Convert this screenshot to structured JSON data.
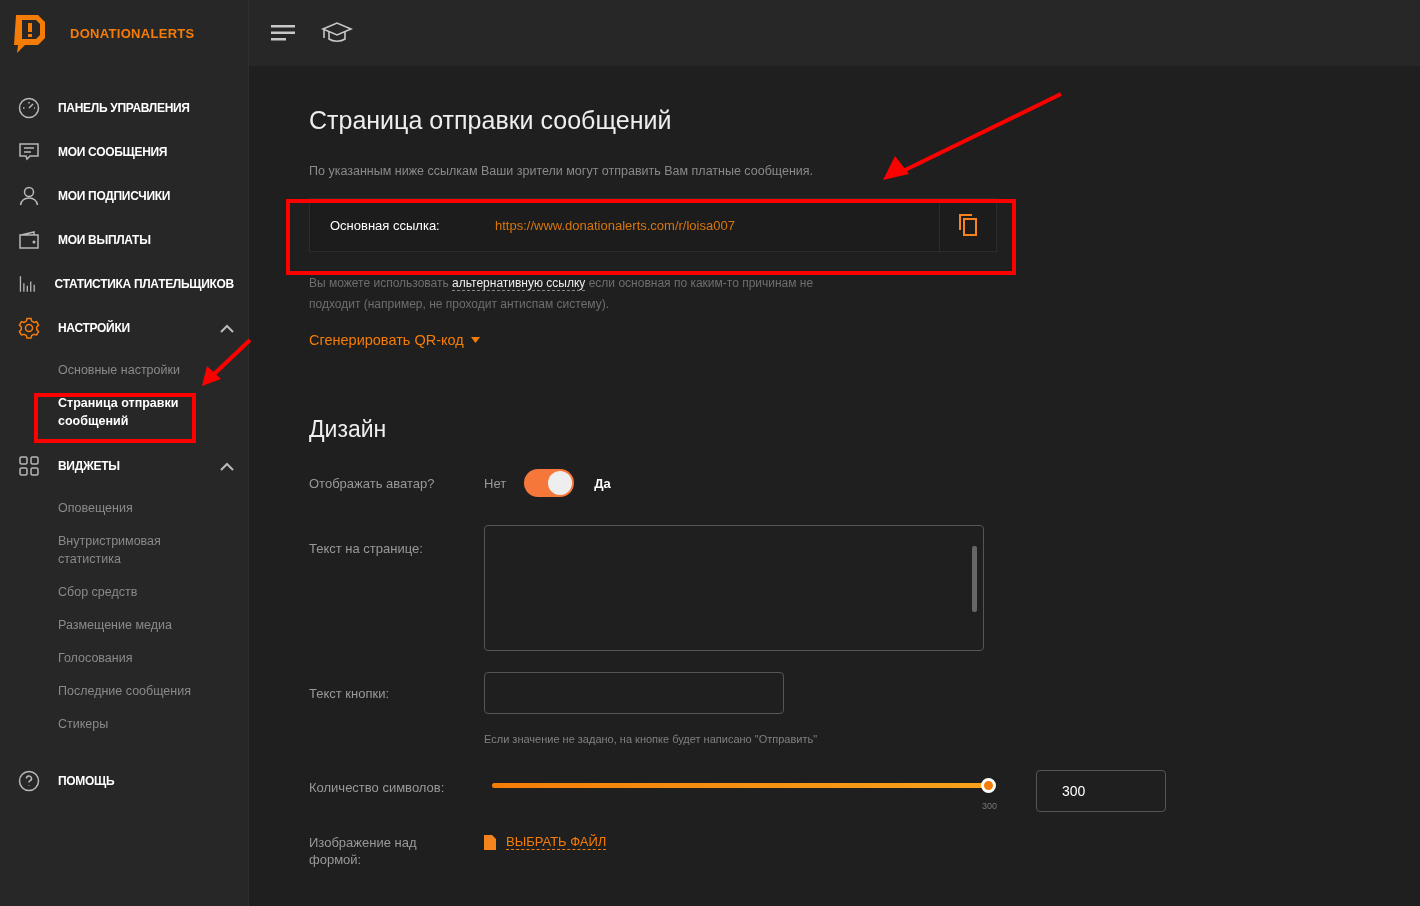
{
  "brand": {
    "name": "DONATIONALERTS"
  },
  "sidebar": {
    "items": [
      {
        "label": "ПАНЕЛЬ УПРАВЛЕНИЯ"
      },
      {
        "label": "МОИ СООБЩЕНИЯ"
      },
      {
        "label": "МОИ ПОДПИСЧИКИ"
      },
      {
        "label": "МОИ ВЫПЛАТЫ"
      },
      {
        "label": "СТАТИСТИКА ПЛАТЕЛЬЩИКОВ"
      },
      {
        "label": "НАСТРОЙКИ",
        "expanded": true,
        "children": [
          {
            "label": "Основные настройки",
            "selected": false
          },
          {
            "label": "Страница отправки сообщений",
            "selected": true
          }
        ]
      },
      {
        "label": "ВИДЖЕТЫ",
        "expanded": true,
        "children": [
          {
            "label": "Оповещения",
            "selected": false
          },
          {
            "label": "Внутристримовая статистика",
            "selected": false
          },
          {
            "label": "Сбор средств",
            "selected": false
          },
          {
            "label": "Размещение медиа",
            "selected": false
          },
          {
            "label": "Голосования",
            "selected": false
          },
          {
            "label": "Последние сообщения",
            "selected": false
          },
          {
            "label": "Стикеры",
            "selected": false
          }
        ]
      },
      {
        "label": "ПОМОЩЬ"
      }
    ]
  },
  "page": {
    "title": "Страница отправки сообщений",
    "description": "По указанным ниже ссылкам Ваши зрители могут отправить Вам платные сообщения.",
    "link_card": {
      "label": "Основная ссылка:",
      "url": "https://www.donationalerts.com/r/loisa007"
    },
    "alt_note": {
      "before": "Вы можете использовать",
      "link": "альтернативную ссылку",
      "after": "если основная по каким-то причинам не подходит (например, не проходит антиспам систему)."
    },
    "qr_button": "Сгенерировать QR-код"
  },
  "design": {
    "title": "Дизайн",
    "avatar": {
      "label": "Отображать аватар?",
      "off_label": "Нет",
      "on_label": "Да",
      "on": true
    },
    "page_text": {
      "label": "Текст на странице:"
    },
    "button_text": {
      "label": "Текст кнопки:",
      "hint": "Если значение не задано, на кнопке будет написано \"Отправить\""
    },
    "char_count": {
      "label": "Количество символов:",
      "level": 1,
      "max_label": "300",
      "value": "300"
    },
    "image": {
      "label": "Изображение над формой:",
      "button": "ВЫБРАТЬ ФАЙЛ"
    }
  }
}
